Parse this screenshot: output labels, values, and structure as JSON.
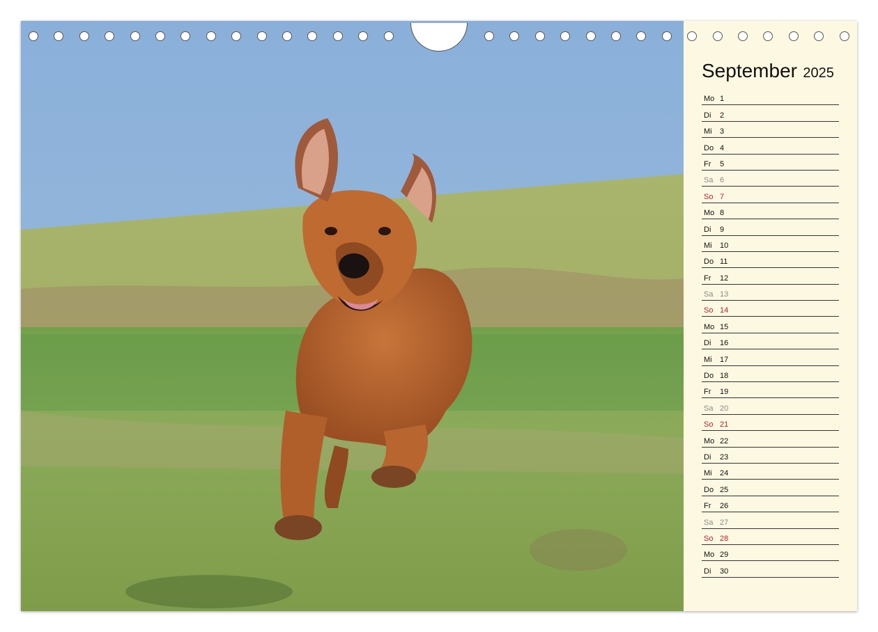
{
  "calendar": {
    "month": "September",
    "year": "2025",
    "days": [
      {
        "wd": "Mo",
        "num": "1",
        "type": "weekday"
      },
      {
        "wd": "Di",
        "num": "2",
        "type": "weekday"
      },
      {
        "wd": "Mi",
        "num": "3",
        "type": "weekday"
      },
      {
        "wd": "Do",
        "num": "4",
        "type": "weekday"
      },
      {
        "wd": "Fr",
        "num": "5",
        "type": "weekday"
      },
      {
        "wd": "Sa",
        "num": "6",
        "type": "sat"
      },
      {
        "wd": "So",
        "num": "7",
        "type": "sun"
      },
      {
        "wd": "Mo",
        "num": "8",
        "type": "weekday"
      },
      {
        "wd": "Di",
        "num": "9",
        "type": "weekday"
      },
      {
        "wd": "Mi",
        "num": "10",
        "type": "weekday"
      },
      {
        "wd": "Do",
        "num": "11",
        "type": "weekday"
      },
      {
        "wd": "Fr",
        "num": "12",
        "type": "weekday"
      },
      {
        "wd": "Sa",
        "num": "13",
        "type": "sat"
      },
      {
        "wd": "So",
        "num": "14",
        "type": "sun"
      },
      {
        "wd": "Mo",
        "num": "15",
        "type": "weekday"
      },
      {
        "wd": "Di",
        "num": "16",
        "type": "weekday"
      },
      {
        "wd": "Mi",
        "num": "17",
        "type": "weekday"
      },
      {
        "wd": "Do",
        "num": "18",
        "type": "weekday"
      },
      {
        "wd": "Fr",
        "num": "19",
        "type": "weekday"
      },
      {
        "wd": "Sa",
        "num": "20",
        "type": "sat"
      },
      {
        "wd": "So",
        "num": "21",
        "type": "sun"
      },
      {
        "wd": "Mo",
        "num": "22",
        "type": "weekday"
      },
      {
        "wd": "Di",
        "num": "23",
        "type": "weekday"
      },
      {
        "wd": "Mi",
        "num": "24",
        "type": "weekday"
      },
      {
        "wd": "Do",
        "num": "25",
        "type": "weekday"
      },
      {
        "wd": "Fr",
        "num": "26",
        "type": "weekday"
      },
      {
        "wd": "Sa",
        "num": "27",
        "type": "sat"
      },
      {
        "wd": "So",
        "num": "28",
        "type": "sun"
      },
      {
        "wd": "Mo",
        "num": "29",
        "type": "weekday"
      },
      {
        "wd": "Di",
        "num": "30",
        "type": "weekday"
      }
    ]
  },
  "colors": {
    "panel_background": "#fdf8e1",
    "saturday": "#8a8a8a",
    "sunday": "#c0242b",
    "sky": "#8eaed6",
    "meadow": "#8aa758",
    "dog": "#b9652d"
  }
}
